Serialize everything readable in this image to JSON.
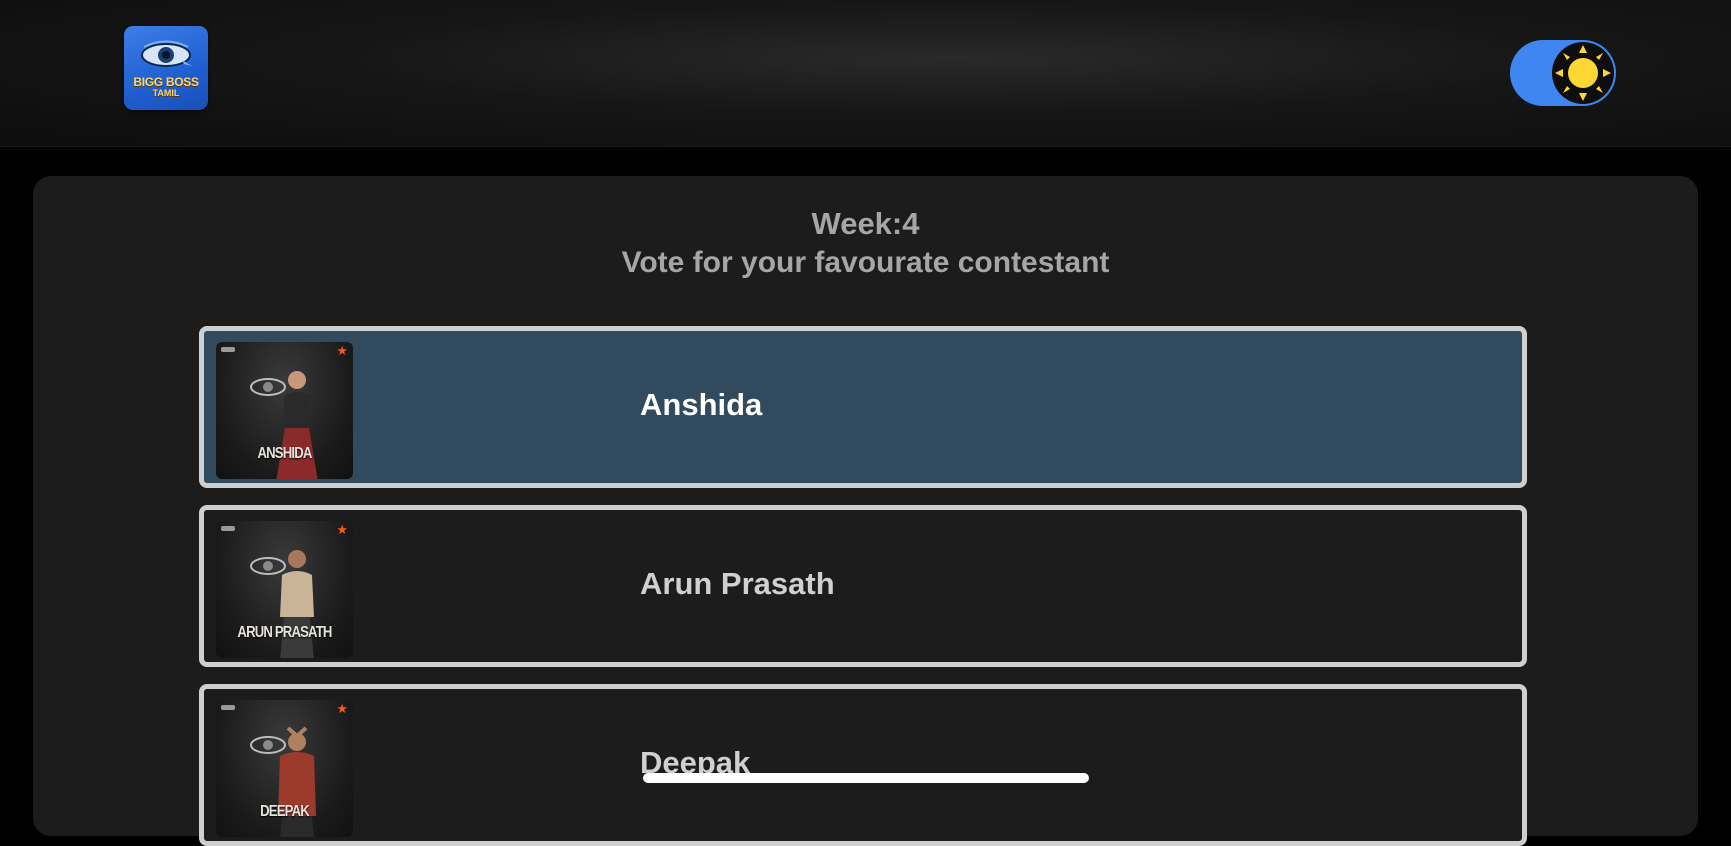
{
  "header": {
    "logo": {
      "line1": "BIGG BOSS",
      "line2": "TAMIL",
      "icon": "bigg-boss-eye-icon"
    },
    "theme_toggle": {
      "icon": "sun-icon",
      "state": "on",
      "track_color": "#3f86f0",
      "sun_color": "#fdd835"
    }
  },
  "poll": {
    "week_title": "Week:4",
    "subtitle": "Vote for your favourate contestant",
    "selected_color": "#324a5d",
    "contestants": [
      {
        "name": "Anshida",
        "photo_caption": "ANSHIDA",
        "selected": true,
        "shirt_color": "#2a2a2a",
        "accent_color": "#8b2a2a"
      },
      {
        "name": "Arun Prasath",
        "photo_caption": "ARUN PRASATH",
        "selected": false,
        "shirt_color": "#c9b497",
        "accent_color": "#3a3a3a"
      },
      {
        "name": "Deepak",
        "photo_caption": "DEEPAK",
        "selected": false,
        "shirt_color": "#9c3b2c",
        "accent_color": "#2a2a2a"
      }
    ]
  }
}
